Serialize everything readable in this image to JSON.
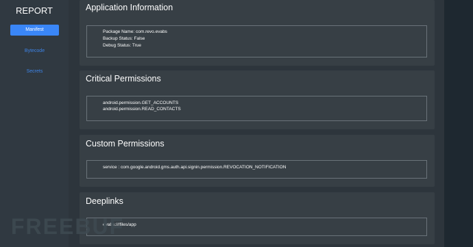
{
  "sidebar": {
    "title": "REPORT",
    "items": [
      {
        "label": "Manifest"
      },
      {
        "label": "Bytecode"
      },
      {
        "label": "Secrets"
      }
    ]
  },
  "sections": [
    {
      "title": "Application Information",
      "lines": [
        "Package Name: com.revo.evabs",
        "Backup Status: False",
        "Debug Status: True"
      ]
    },
    {
      "title": "Critical Permissions",
      "lines": [
        "android.permission.GET_ACCOUNTS",
        "android.permission.READ_CONTACTS"
      ]
    },
    {
      "title": "Custom Permissions",
      "lines": [
        "service : com.google.android.gms.auth.api.signin.permission.REVOCATION_NOTIFICATION"
      ]
    },
    {
      "title": "Deeplinks",
      "lines": [
        "evabs:///files/app"
      ]
    }
  ],
  "watermark": "FREEBUF",
  "colors": {
    "accent": "#3a86f7",
    "sidebar": "#303941",
    "card": "#373f45"
  }
}
